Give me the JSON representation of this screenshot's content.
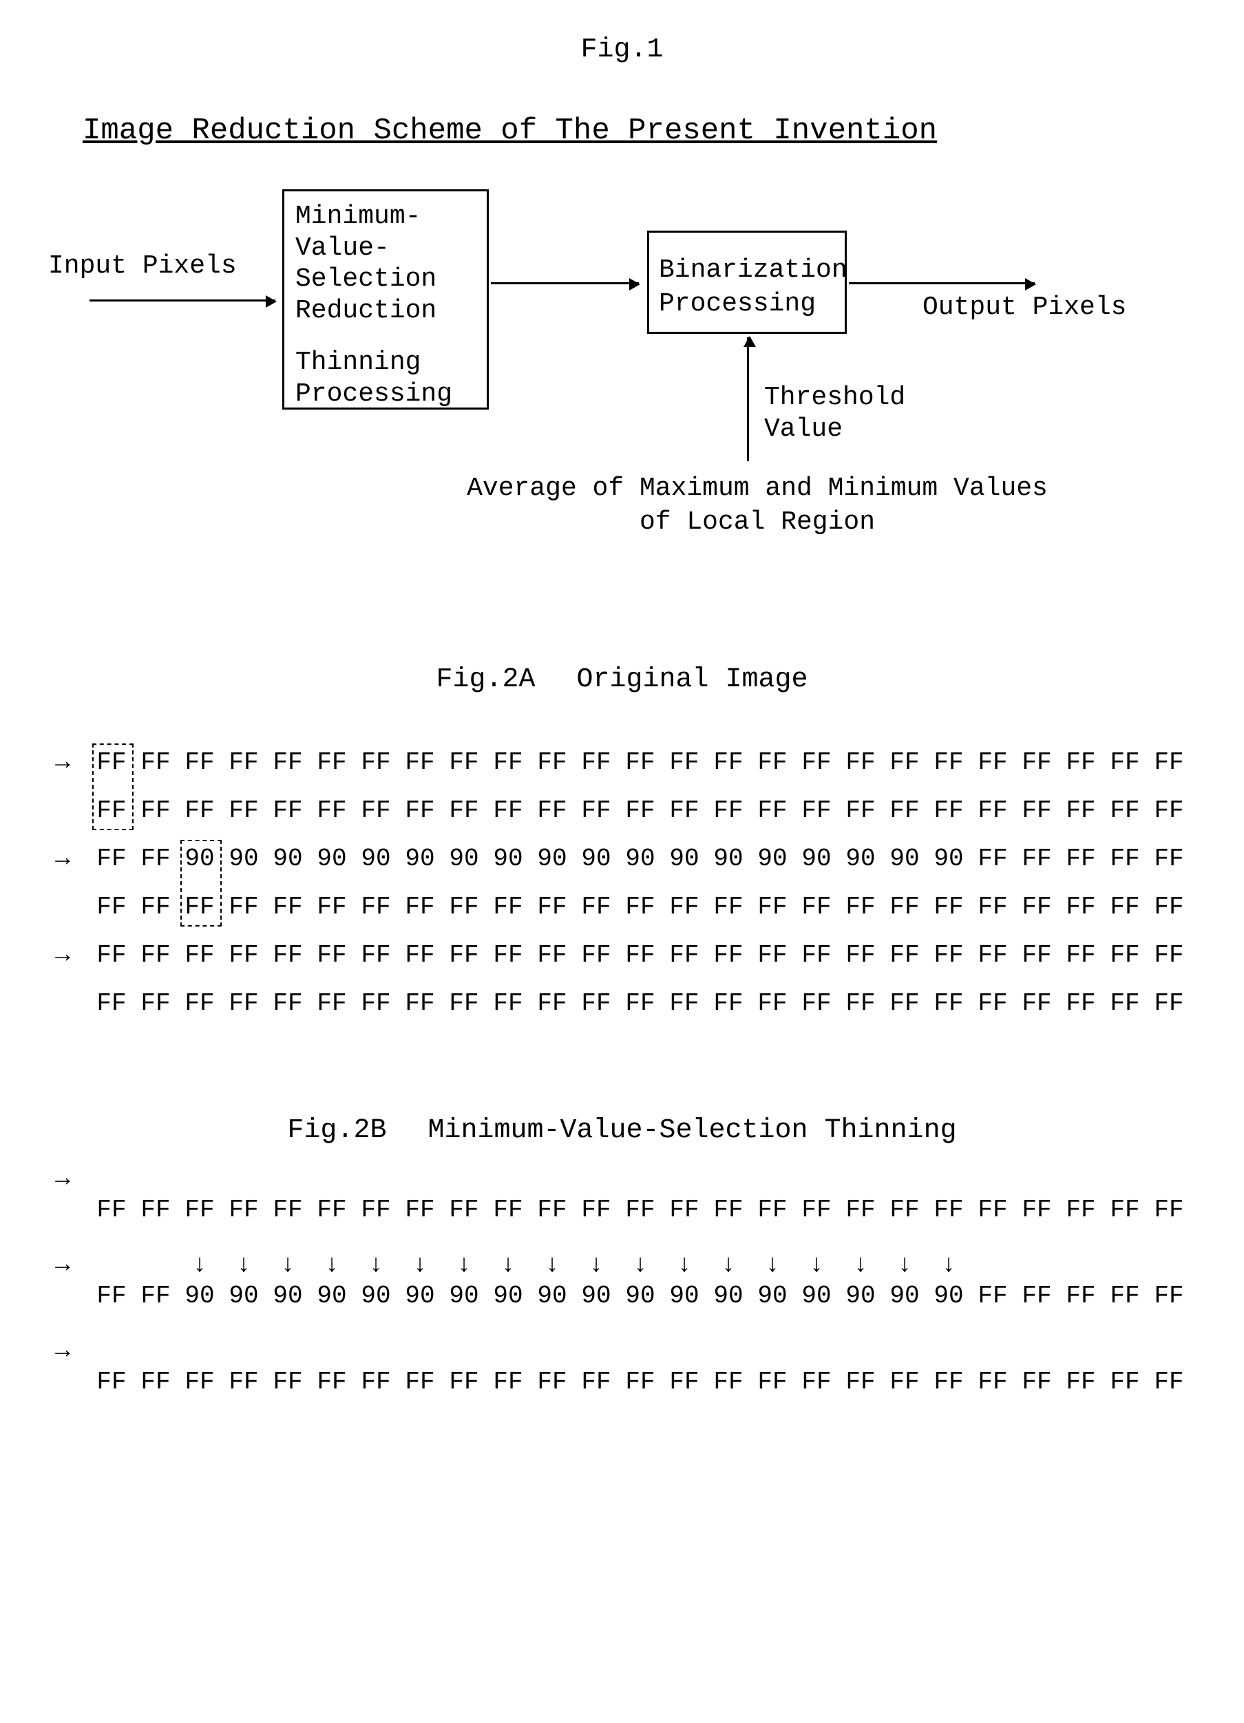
{
  "fig1": {
    "label": "Fig.1",
    "title": "Image Reduction Scheme of The Present Invention",
    "input_label": "Input Pixels",
    "box1_top": "Minimum-\nValue-\nSelection\nReduction",
    "box1_bottom": "Thinning\nProcessing",
    "box2": "Binarization\nProcessing",
    "output_label": "Output Pixels",
    "threshold": "Threshold\nValue",
    "average_line1": "Average of Maximum and Minimum Values",
    "average_line2": "of Local Region"
  },
  "fig2a": {
    "label": "Fig.2A",
    "title": "Original Image",
    "rows": [
      [
        "FF",
        "FF",
        "FF",
        "FF",
        "FF",
        "FF",
        "FF",
        "FF",
        "FF",
        "FF",
        "FF",
        "FF",
        "FF",
        "FF",
        "FF",
        "FF",
        "FF",
        "FF",
        "FF",
        "FF",
        "FF",
        "FF",
        "FF",
        "FF",
        "FF"
      ],
      [
        "FF",
        "FF",
        "FF",
        "FF",
        "FF",
        "FF",
        "FF",
        "FF",
        "FF",
        "FF",
        "FF",
        "FF",
        "FF",
        "FF",
        "FF",
        "FF",
        "FF",
        "FF",
        "FF",
        "FF",
        "FF",
        "FF",
        "FF",
        "FF",
        "FF"
      ],
      [
        "FF",
        "FF",
        "90",
        "90",
        "90",
        "90",
        "90",
        "90",
        "90",
        "90",
        "90",
        "90",
        "90",
        "90",
        "90",
        "90",
        "90",
        "90",
        "90",
        "90",
        "FF",
        "FF",
        "FF",
        "FF",
        "FF"
      ],
      [
        "FF",
        "FF",
        "FF",
        "FF",
        "FF",
        "FF",
        "FF",
        "FF",
        "FF",
        "FF",
        "FF",
        "FF",
        "FF",
        "FF",
        "FF",
        "FF",
        "FF",
        "FF",
        "FF",
        "FF",
        "FF",
        "FF",
        "FF",
        "FF",
        "FF"
      ],
      [
        "FF",
        "FF",
        "FF",
        "FF",
        "FF",
        "FF",
        "FF",
        "FF",
        "FF",
        "FF",
        "FF",
        "FF",
        "FF",
        "FF",
        "FF",
        "FF",
        "FF",
        "FF",
        "FF",
        "FF",
        "FF",
        "FF",
        "FF",
        "FF",
        "FF"
      ],
      [
        "FF",
        "FF",
        "FF",
        "FF",
        "FF",
        "FF",
        "FF",
        "FF",
        "FF",
        "FF",
        "FF",
        "FF",
        "FF",
        "FF",
        "FF",
        "FF",
        "FF",
        "FF",
        "FF",
        "FF",
        "FF",
        "FF",
        "FF",
        "FF",
        "FF"
      ]
    ],
    "arrow_rows": [
      0,
      2,
      4
    ],
    "dashed_box1": {
      "row": 0,
      "col": 0,
      "rowspan": 2,
      "colspan": 1
    },
    "dashed_box2": {
      "row": 2,
      "col": 2,
      "rowspan": 2,
      "colspan": 1
    }
  },
  "fig2b": {
    "label": "Fig.2B",
    "title": "Minimum-Value-Selection Thinning",
    "rows": [
      [
        "FF",
        "FF",
        "FF",
        "FF",
        "FF",
        "FF",
        "FF",
        "FF",
        "FF",
        "FF",
        "FF",
        "FF",
        "FF",
        "FF",
        "FF",
        "FF",
        "FF",
        "FF",
        "FF",
        "FF",
        "FF",
        "FF",
        "FF",
        "FF",
        "FF"
      ],
      [
        "FF",
        "FF",
        "90",
        "90",
        "90",
        "90",
        "90",
        "90",
        "90",
        "90",
        "90",
        "90",
        "90",
        "90",
        "90",
        "90",
        "90",
        "90",
        "90",
        "90",
        "FF",
        "FF",
        "FF",
        "FF",
        "FF"
      ],
      [
        "FF",
        "FF",
        "FF",
        "FF",
        "FF",
        "FF",
        "FF",
        "FF",
        "FF",
        "FF",
        "FF",
        "FF",
        "FF",
        "FF",
        "FF",
        "FF",
        "FF",
        "FF",
        "FF",
        "FF",
        "FF",
        "FF",
        "FF",
        "FF",
        "FF"
      ]
    ],
    "down_arrows_cols": [
      2,
      3,
      4,
      5,
      6,
      7,
      8,
      9,
      10,
      11,
      12,
      13,
      14,
      15,
      16,
      17,
      18,
      19
    ],
    "arrow_glyph": "↓",
    "row_arrow_glyph": "→"
  }
}
